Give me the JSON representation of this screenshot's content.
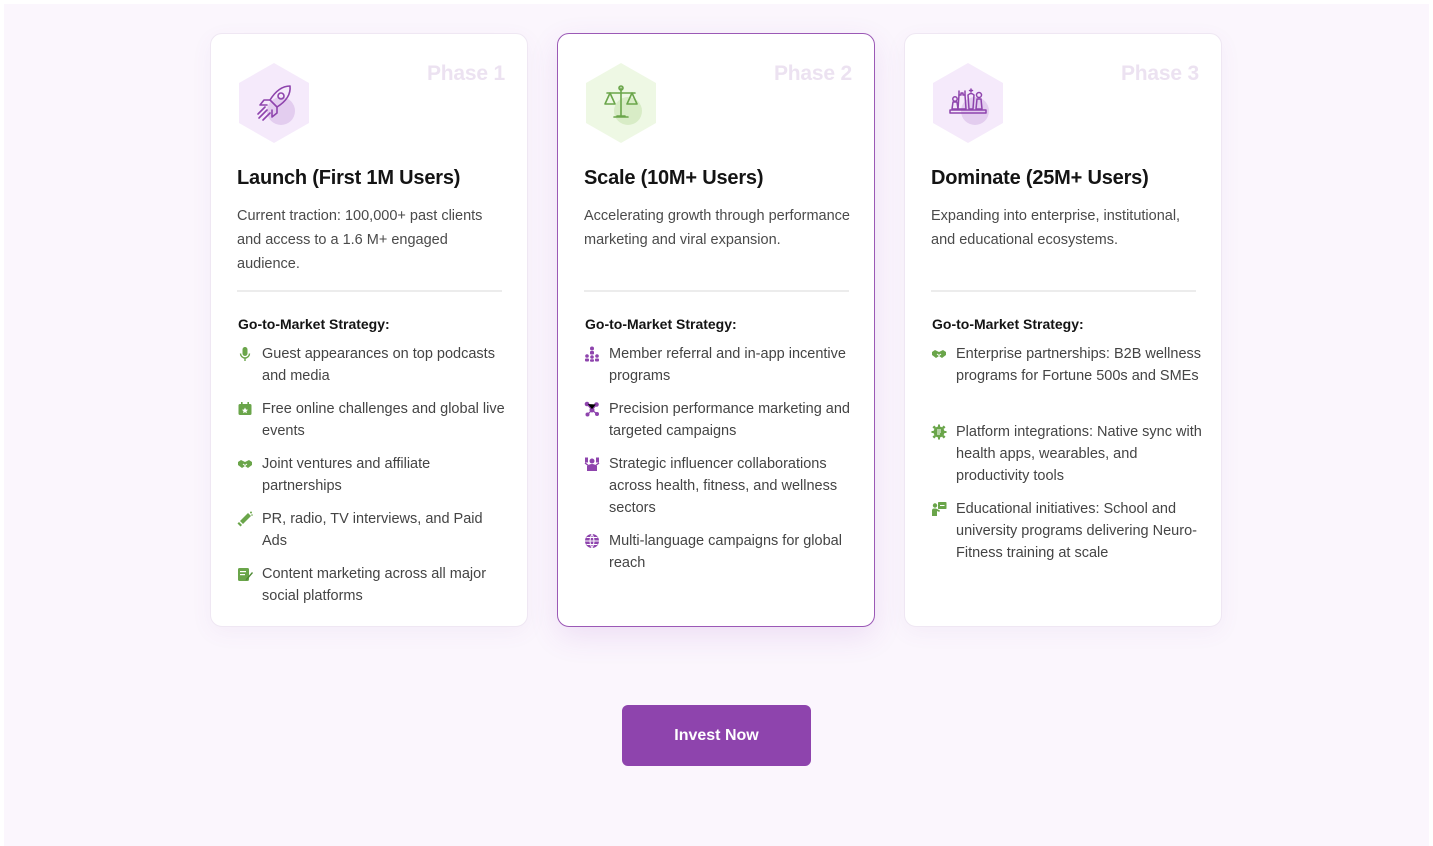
{
  "colors": {
    "background": "#fbf6fd",
    "accent_purple": "#8e44ad",
    "icon_green": "#6aa54a",
    "icon_purple": "#8e44ad",
    "phase_label": "#ece2f1"
  },
  "phases": [
    {
      "phase_label": "Phase 1",
      "icon": "rocket-icon",
      "title": "Launch (First 1M Users)",
      "description": "Current traction: 100,000+ past clients and access to a 1.6 M+ engaged audience.",
      "gtm_heading": "Go-to-Market Strategy:",
      "items": [
        {
          "icon": "microphone-icon",
          "text": "Guest appearances on top podcasts and media"
        },
        {
          "icon": "calendar-icon",
          "text": "Free online challenges and global live events"
        },
        {
          "icon": "handshake-icon",
          "text": "Joint ventures and affiliate partnerships"
        },
        {
          "icon": "megaphone-icon",
          "text": "PR, radio, TV interviews, and Paid Ads"
        },
        {
          "icon": "edit-note-icon",
          "text": "Content marketing across all major social platforms"
        }
      ]
    },
    {
      "phase_label": "Phase 2",
      "icon": "balance-scale-icon",
      "title": "Scale (10M+ Users)",
      "description": "Accelerating growth through performance marketing and viral expansion.",
      "gtm_heading": "Go-to-Market Strategy:",
      "items": [
        {
          "icon": "referral-network-icon",
          "text": "Member referral and in-app incentive programs"
        },
        {
          "icon": "target-network-icon",
          "text": "Precision performance marketing and targeted campaigns"
        },
        {
          "icon": "influencer-icon",
          "text": "Strategic influencer collaborations across health, fitness, and wellness sectors"
        },
        {
          "icon": "globe-icon",
          "text": "Multi-language campaigns for global reach"
        }
      ]
    },
    {
      "phase_label": "Phase 3",
      "icon": "chess-pieces-icon",
      "title": "Dominate (25M+ Users)",
      "description": "Expanding into enterprise, institutional, and educational ecosystems.",
      "gtm_heading": "Go-to-Market Strategy:",
      "items": [
        {
          "icon": "handshake-icon",
          "text": "Enterprise partnerships: B2B wellness programs for Fortune 500s and SMEs"
        },
        {
          "icon": "integration-gear-icon",
          "text": "Platform integrations: Native sync with health apps, wearables, and productivity tools"
        },
        {
          "icon": "teacher-board-icon",
          "text": "Educational initiatives: School and university programs delivering Neuro-Fitness training at scale"
        }
      ]
    }
  ],
  "cta": {
    "label": "Invest Now"
  }
}
